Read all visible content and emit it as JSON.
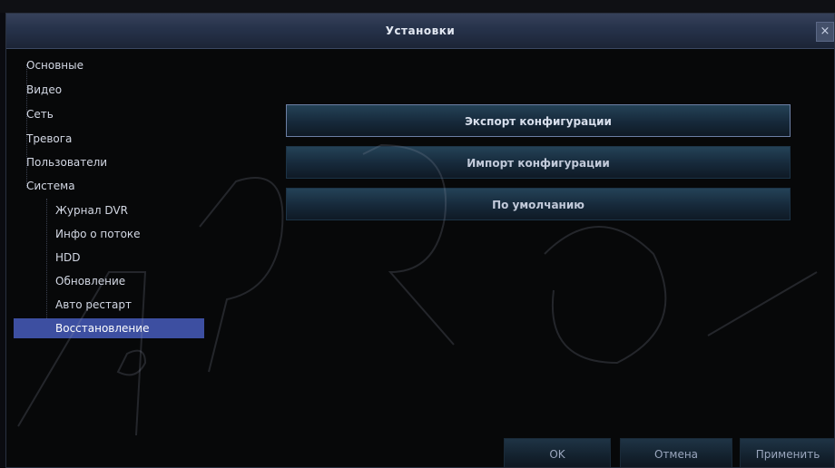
{
  "window": {
    "title": "Установки",
    "close_label": "×"
  },
  "sidebar": {
    "items": [
      {
        "label": "Основные"
      },
      {
        "label": "Видео"
      },
      {
        "label": "Сеть"
      },
      {
        "label": "Тревога"
      },
      {
        "label": "Пользователи"
      },
      {
        "label": "Система"
      },
      {
        "label": "Журнал DVR"
      },
      {
        "label": "Инфо о потоке"
      },
      {
        "label": "HDD"
      },
      {
        "label": "Обновление"
      },
      {
        "label": "Авто рестарт"
      },
      {
        "label": "Восстановление",
        "selected": true
      }
    ]
  },
  "actions": {
    "export_label": "Экспорт конфигурации",
    "import_label": "Импорт конфигурации",
    "default_label": "По умолчанию"
  },
  "footer": {
    "ok_label": "OK",
    "cancel_label": "Отмена",
    "apply_label": "Применить"
  },
  "colors": {
    "selection": "#3d4fa1",
    "titlebar": "#2a3550",
    "background": "#070809"
  }
}
